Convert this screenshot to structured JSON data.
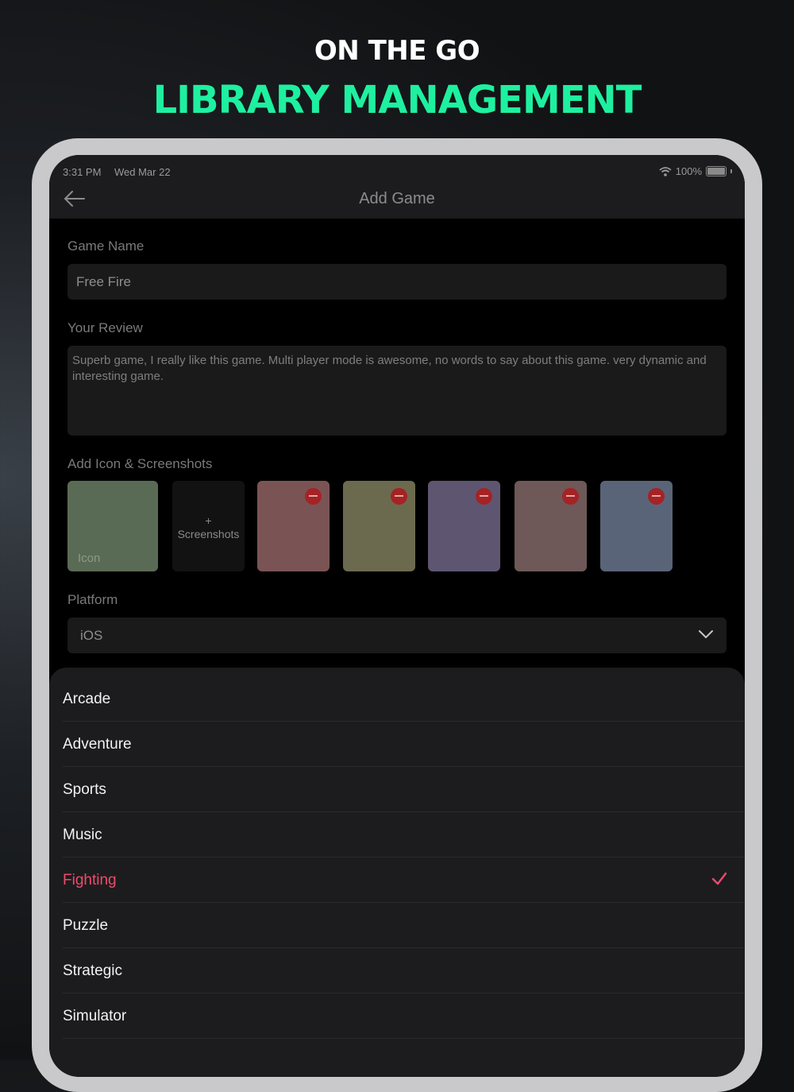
{
  "promo": {
    "line1": "ON THE GO",
    "line2": "LIBRARY MANAGEMENT"
  },
  "statusbar": {
    "time": "3:31 PM",
    "date": "Wed Mar 22",
    "battery": "100%"
  },
  "nav": {
    "title": "Add Game"
  },
  "form": {
    "game_name_label": "Game Name",
    "game_name_value": "Free Fire",
    "review_label": "Your Review",
    "review_value": "Superb game, I really like this game. Multi player mode is awesome, no words to say about this game. very dynamic and interesting game.",
    "media_label": "Add Icon & Screenshots",
    "icon_label": "Icon",
    "add_plus": "+",
    "add_screenshots_label": "Screenshots",
    "screenshots": [
      {
        "color": "#7a5454"
      },
      {
        "color": "#6c6a4e"
      },
      {
        "color": "#5e5670"
      },
      {
        "color": "#6e5858"
      },
      {
        "color": "#5a6478"
      }
    ],
    "platform_label": "Platform",
    "platform_value": "iOS"
  },
  "genres": {
    "options": [
      "Arcade",
      "Adventure",
      "Sports",
      "Music",
      "Fighting",
      "Puzzle",
      "Strategic",
      "Simulator"
    ],
    "selected": "Fighting",
    "accent": "#ef4a6c"
  }
}
